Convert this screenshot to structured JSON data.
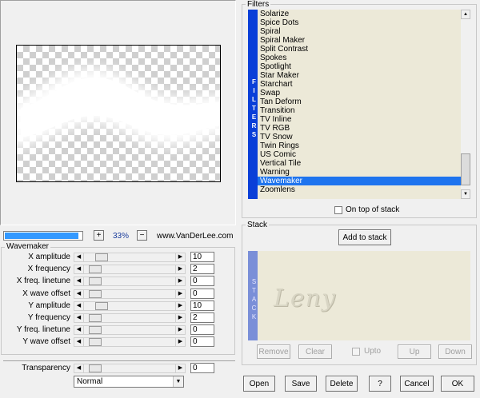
{
  "preview": {
    "zoom": "33%",
    "zoom_in": "+",
    "zoom_out": "−",
    "credit": "www.VanDerLee.com",
    "progress": 0.95
  },
  "wavemaker": {
    "title": "Wavemaker",
    "params": [
      {
        "label": "X amplitude",
        "value": "10",
        "thumb": 0.08
      },
      {
        "label": "X frequency",
        "value": "2",
        "thumb": 0.0
      },
      {
        "label": "X freq. linetune",
        "value": "0",
        "thumb": 0.0
      },
      {
        "label": "X wave offset",
        "value": "0",
        "thumb": 0.0
      },
      {
        "label": "Y amplitude",
        "value": "10",
        "thumb": 0.08
      },
      {
        "label": "Y frequency",
        "value": "2",
        "thumb": 0.0
      },
      {
        "label": "Y freq. linetune",
        "value": "0",
        "thumb": 0.0
      },
      {
        "label": "Y wave offset",
        "value": "0",
        "thumb": 0.0
      }
    ],
    "transparency": {
      "label": "Transparency",
      "value": "0",
      "thumb": 0.0
    },
    "blend": "Normal"
  },
  "filters": {
    "title": "Filters",
    "side_label": "FILTERS",
    "items": [
      "Solarize",
      "Spice Dots",
      "Spiral",
      "Spiral Maker",
      "Split Contrast",
      "Spokes",
      "Spotlight",
      "Star Maker",
      "Starchart",
      "Swap",
      "Tan Deform",
      "Transition",
      "TV Inline",
      "TV RGB",
      "TV Snow",
      "Twin Rings",
      "US Comic",
      "Vertical Tile",
      "Warning",
      "Wavemaker",
      "Zoomlens"
    ],
    "selected": "Wavemaker",
    "on_top_label": "On top of stack"
  },
  "stack": {
    "title": "Stack",
    "side_label": "STACK",
    "add_label": "Add to stack",
    "watermark": "Leny",
    "remove": "Remove",
    "clear": "Clear",
    "upto": "Upto",
    "up": "Up",
    "down": "Down"
  },
  "footer": {
    "open": "Open",
    "save": "Save",
    "delete": "Delete",
    "help": "?",
    "cancel": "Cancel",
    "ok": "OK"
  }
}
